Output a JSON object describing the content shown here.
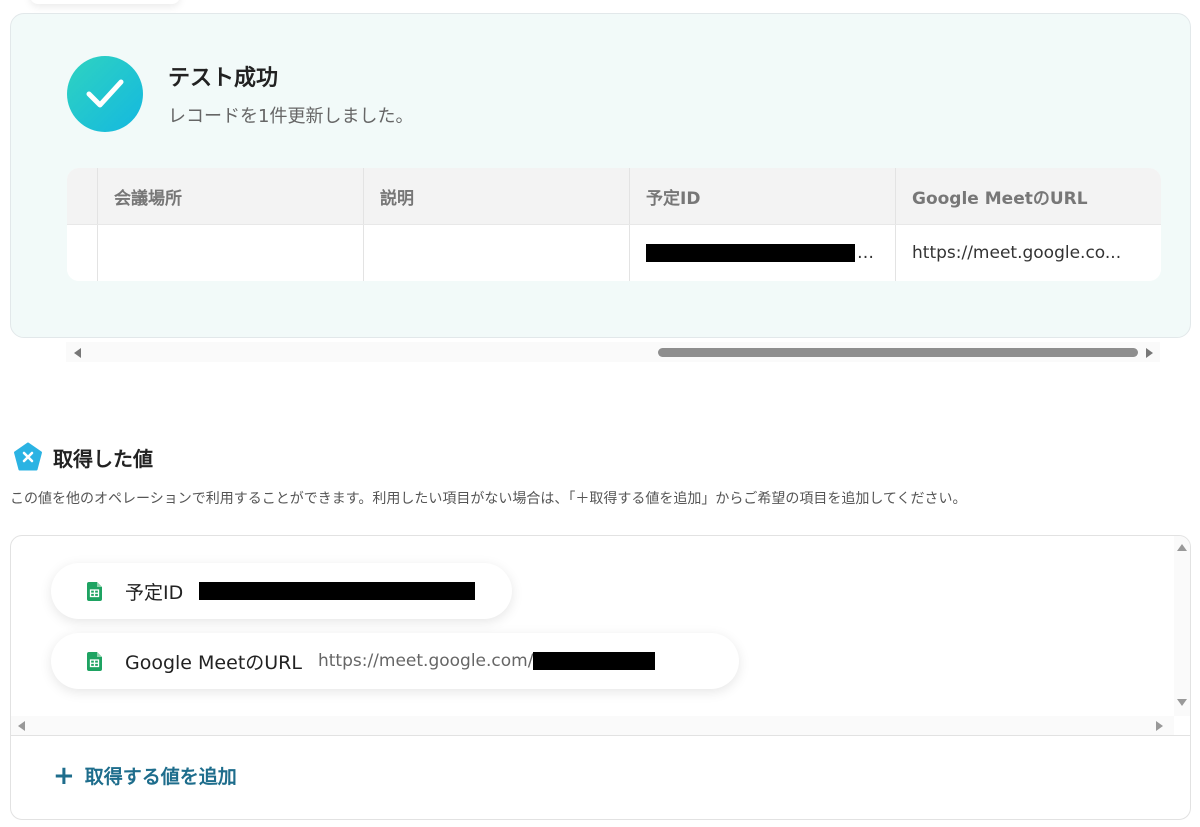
{
  "success": {
    "title": "テスト成功",
    "message": "レコードを1件更新しました。"
  },
  "result_table": {
    "headers": [
      "",
      "会議場所",
      "説明",
      "予定ID",
      "Google MeetのURL"
    ],
    "row": [
      "",
      "",
      "",
      "…",
      "https://meet.google.co..."
    ]
  },
  "obtained": {
    "title": "取得した値",
    "description": "この値を他のオペレーションで利用することができます。利用したい項目がない場合は、「＋取得する値を追加」からご希望の項目を追加してください。",
    "items": [
      {
        "label": "予定ID",
        "value": ""
      },
      {
        "label": "Google MeetのURL",
        "value": "https://meet.google.com/"
      }
    ],
    "add_button_label": "取得する値を追加",
    "add_icon": "+"
  },
  "icons": {
    "success": "check-icon",
    "section": "variable-x-icon",
    "item": "google-sheets-icon",
    "add": "plus-icon"
  },
  "colors": {
    "accent": "#1e6d8c",
    "success_gradient_start": "#2fd3c0",
    "success_gradient_end": "#14b8e0",
    "sheets_green": "#1ea362",
    "panel_bg": "#f2faf9"
  }
}
